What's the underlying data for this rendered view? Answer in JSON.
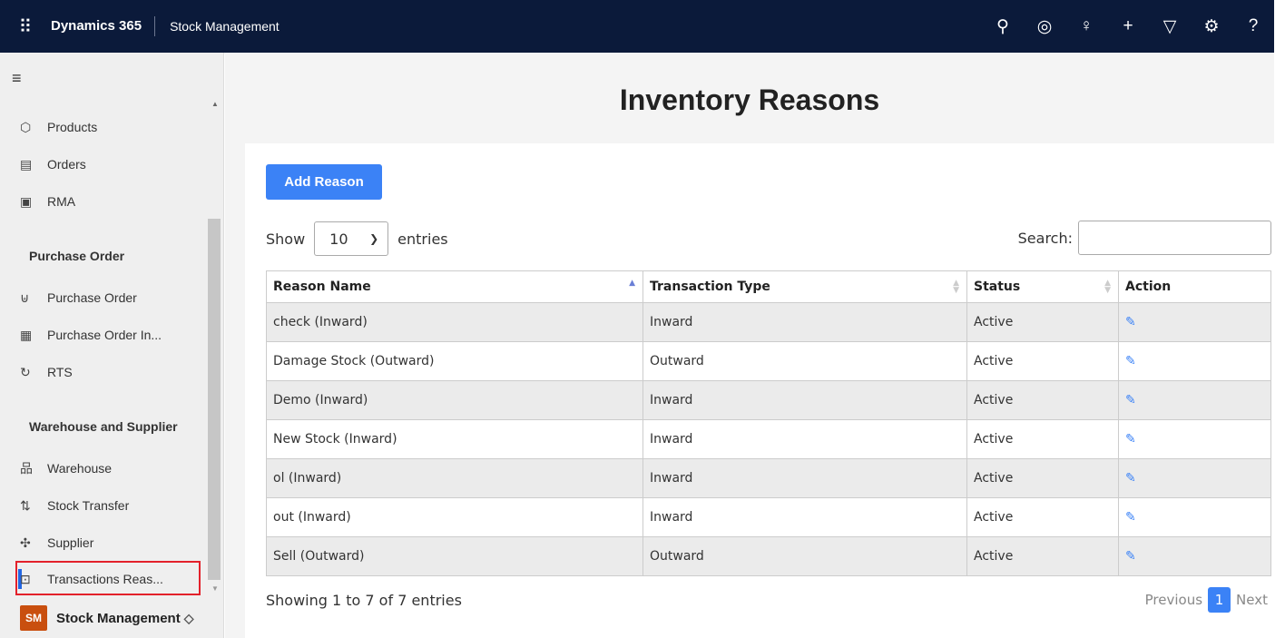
{
  "header": {
    "brand": "Dynamics 365",
    "app_name": "Stock Management",
    "icons": [
      "search-icon",
      "target-icon",
      "lightbulb-icon",
      "plus-icon",
      "filter-icon",
      "gear-icon",
      "help-icon"
    ]
  },
  "sidebar": {
    "items": [
      {
        "label": "Products",
        "icon": "box-icon"
      },
      {
        "label": "Orders",
        "icon": "document-icon"
      },
      {
        "label": "RMA",
        "icon": "rma-icon"
      }
    ],
    "purchase_section": "Purchase Order",
    "purchase_items": [
      {
        "label": "Purchase Order",
        "icon": "purchase-icon"
      },
      {
        "label": "Purchase Order In...",
        "icon": "invoice-icon"
      },
      {
        "label": "RTS",
        "icon": "return-icon"
      }
    ],
    "warehouse_section": "Warehouse and Supplier",
    "warehouse_items": [
      {
        "label": "Warehouse",
        "icon": "warehouse-icon"
      },
      {
        "label": "Stock Transfer",
        "icon": "transfer-icon"
      },
      {
        "label": "Supplier",
        "icon": "supplier-icon"
      },
      {
        "label": "Transactions Reas...",
        "icon": "transactions-icon"
      }
    ],
    "area": {
      "badge": "SM",
      "label": "Stock Management"
    }
  },
  "main": {
    "title": "Inventory Reasons",
    "add_button": "Add Reason",
    "show_label": "Show",
    "entries_value": "10",
    "entries_label": "entries",
    "search_label": "Search:",
    "columns": [
      "Reason Name",
      "Transaction Type",
      "Status",
      "Action"
    ],
    "rows": [
      {
        "name": "check (Inward)",
        "type": "Inward",
        "status": "Active"
      },
      {
        "name": "Damage Stock (Outward)",
        "type": "Outward",
        "status": "Active"
      },
      {
        "name": "Demo (Inward)",
        "type": "Inward",
        "status": "Active"
      },
      {
        "name": "New Stock (Inward)",
        "type": "Inward",
        "status": "Active"
      },
      {
        "name": "ol (Inward)",
        "type": "Inward",
        "status": "Active"
      },
      {
        "name": "out (Inward)",
        "type": "Inward",
        "status": "Active"
      },
      {
        "name": "Sell (Outward)",
        "type": "Outward",
        "status": "Active"
      }
    ],
    "info": "Showing 1 to 7 of 7 entries",
    "pager": {
      "previous": "Previous",
      "page": "1",
      "next": "Next"
    }
  },
  "colors": {
    "topbar": "#0b1a3a",
    "accent": "#3b82f6",
    "highlight_border": "#e3212b",
    "area_badge": "#c94f0f"
  }
}
